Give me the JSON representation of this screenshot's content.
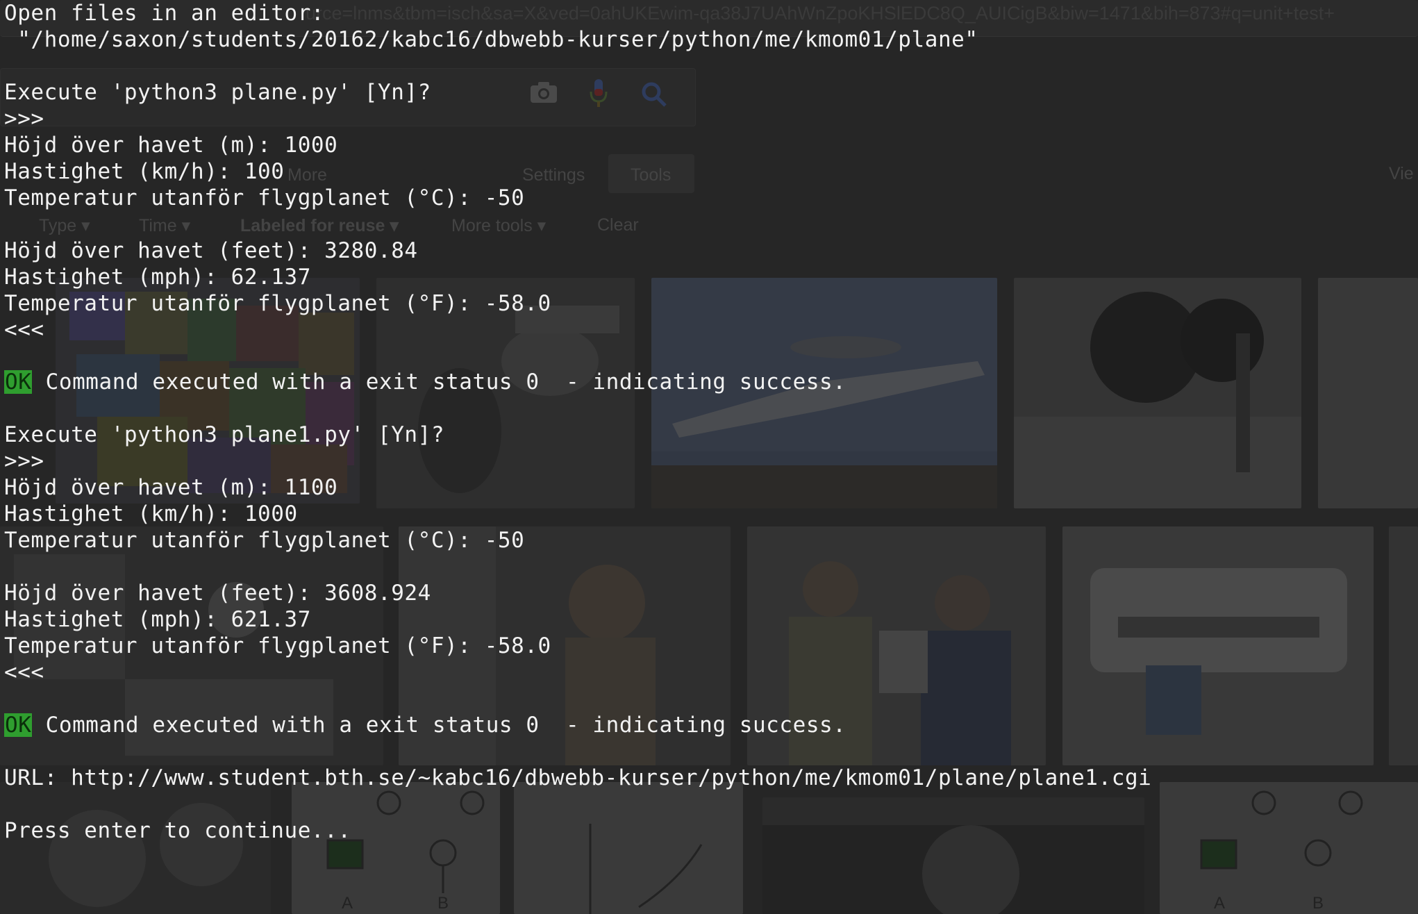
{
  "background": {
    "browser_url": "urce=lnms&tbm=isch&sa=X&ved=0ahUKEwim-qa38J7UAhWnZpoKHSlEDC8Q_AUICigB&biw=1471&bih=873#q=unit+test+",
    "nav": {
      "more": "More",
      "settings": "Settings",
      "tools": "Tools",
      "view": "Vie"
    },
    "tools_row": [
      "Type ▾",
      "Time ▾",
      "Labeled for reuse ▾",
      "More tools ▾",
      "Clear"
    ],
    "icons": [
      "camera-icon",
      "microphone-icon",
      "search-icon"
    ]
  },
  "terminal": {
    "open_files_label": "Open files in an editor:",
    "open_files_path": " \"/home/saxon/students/20162/kabc16/dbwebb-kurser/python/me/kmom01/plane\"",
    "runs": [
      {
        "execute_prompt": "Execute 'python3 plane.py' [Yn]?",
        "input_marker": ">>>",
        "altitude_m": "Höjd över havet (m): 1000",
        "speed_kmh": "Hastighet (km/h): 100",
        "temp_c": "Temperatur utanför flygplanet (°C): -50",
        "altitude_feet": "Höjd över havet (feet): 3280.84",
        "speed_mph": "Hastighet (mph): 62.137",
        "temp_f": "Temperatur utanför flygplanet (°F): -58.0",
        "output_marker": "<<<",
        "status_badge": "OK",
        "status_message": " Command executed with a exit status 0  - indicating success."
      },
      {
        "execute_prompt": "Execute 'python3 plane1.py' [Yn]?",
        "input_marker": ">>>",
        "altitude_m": "Höjd över havet (m): 1100",
        "speed_kmh": "Hastighet (km/h): 1000",
        "temp_c": "Temperatur utanför flygplanet (°C): -50",
        "altitude_feet": "Höjd över havet (feet): 3608.924",
        "speed_mph": "Hastighet (mph): 621.37",
        "temp_f": "Temperatur utanför flygplanet (°F): -58.0",
        "output_marker": "<<<",
        "status_badge": "OK",
        "status_message": " Command executed with a exit status 0  - indicating success."
      }
    ],
    "url_line": "URL: http://www.student.bth.se/~kabc16/dbwebb-kurser/python/me/kmom01/plane/plane1.cgi",
    "continue_prompt": "Press enter to continue..."
  },
  "colors": {
    "terminal_bg": "#262626",
    "terminal_text": "#f2f2f2",
    "ok_badge": "#2f9e2f"
  }
}
